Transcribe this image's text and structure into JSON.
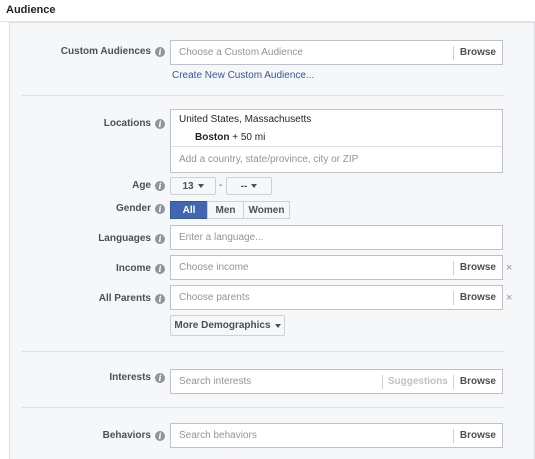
{
  "section_title": "Audience",
  "custom_audiences": {
    "label": "Custom Audiences",
    "placeholder": "Choose a Custom Audience",
    "browse": "Browse",
    "create_link": "Create New Custom Audience..."
  },
  "locations": {
    "label": "Locations",
    "country": "United States, Massachusetts",
    "city": "Boston",
    "radius": "+ 50 mi",
    "placeholder": "Add a country, state/province, city or ZIP"
  },
  "age": {
    "label": "Age",
    "min": "13",
    "separator": "-",
    "max": "--"
  },
  "gender": {
    "label": "Gender",
    "options": [
      "All",
      "Men",
      "Women"
    ],
    "selected": "All"
  },
  "languages": {
    "label": "Languages",
    "placeholder": "Enter a language..."
  },
  "income": {
    "label": "Income",
    "placeholder": "Choose income",
    "browse": "Browse",
    "remove": "×"
  },
  "parents": {
    "label": "All Parents",
    "placeholder": "Choose parents",
    "browse": "Browse",
    "remove": "×"
  },
  "more_demographics": "More Demographics",
  "interests": {
    "label": "Interests",
    "placeholder": "Search interests",
    "suggestions": "Suggestions",
    "browse": "Browse"
  },
  "behaviors": {
    "label": "Behaviors",
    "placeholder": "Search behaviors",
    "browse": "Browse"
  },
  "info_glyph": "i"
}
